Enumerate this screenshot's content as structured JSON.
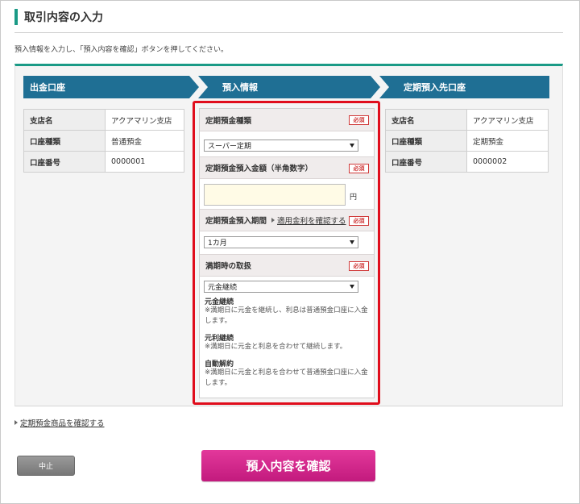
{
  "page": {
    "title": "取引内容の入力",
    "instruction": "預入情報を入力し、「預入内容を確認」ボタンを押してください。"
  },
  "steps": [
    "出金口座",
    "預入情報",
    "定期預入先口座"
  ],
  "withdrawal_account": {
    "rows": [
      {
        "label": "支店名",
        "value": "アクアマリン支店"
      },
      {
        "label": "口座種類",
        "value": "普通預金"
      },
      {
        "label": "口座番号",
        "value": "0000001"
      }
    ]
  },
  "deposit_account": {
    "rows": [
      {
        "label": "支店名",
        "value": "アクアマリン支店"
      },
      {
        "label": "口座種類",
        "value": "定期預金"
      },
      {
        "label": "口座番号",
        "value": "0000002"
      }
    ]
  },
  "form": {
    "required_label": "必須",
    "type": {
      "label": "定期預金種類",
      "selected": "スーパー定期"
    },
    "amount": {
      "label": "定期預金預入金額（半角数字）",
      "value": "",
      "unit": "円"
    },
    "period": {
      "label": "定期預金預入期間",
      "rate_link": "適用金利を確認する",
      "selected": "1カ月"
    },
    "maturity": {
      "label": "満期時の取扱",
      "selected": "元金継続",
      "options": [
        {
          "title": "元金継続",
          "desc": "※満期日に元金を継続し、利息は普通預金口座に入金します。"
        },
        {
          "title": "元利継続",
          "desc": "※満期日に元金と利息を合わせて継続します。"
        },
        {
          "title": "自動解約",
          "desc": "※満期日に元金と利息を合わせて普通預金口座に入金します。"
        }
      ]
    }
  },
  "links": {
    "products": "定期預金商品を確認する"
  },
  "buttons": {
    "cancel": "中止",
    "confirm": "預入内容を確認"
  },
  "colors": {
    "accent": "#1a9a86",
    "step": "#1f6f94",
    "highlight": "#e00d1c",
    "confirm": "#d2268c"
  }
}
